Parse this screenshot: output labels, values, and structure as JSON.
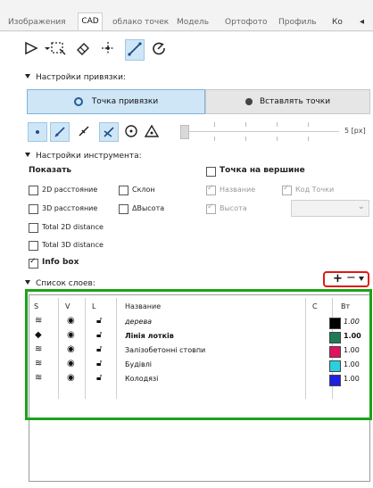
{
  "tabs": [
    "Изображения",
    "CAD",
    "облако точек",
    "Модель",
    "Ортофото",
    "Профиль",
    "Ко"
  ],
  "snap_settings": {
    "title": "Настройки привязки:",
    "snap_point_label": "Точка привязки",
    "insert_points_label": "Вставлять точки",
    "slider_value": "5 [px]"
  },
  "tool_settings": {
    "title": "Настройки инструмента:",
    "show_label": "Показать",
    "point_on_vertex_label": "Точка на вершине",
    "options": {
      "dist2d": "2D расстояние",
      "slope": "Склон",
      "dist3d": "3D расстояние",
      "dheight": "ΔВысота",
      "total2d": "Total 2D distance",
      "total3d": "Total 3D distance",
      "infobox": "Info box",
      "name": "Название",
      "height": "Высота",
      "point_code": "Код Точки"
    }
  },
  "layers": {
    "title": "Список слоев:",
    "controls": {
      "add": "+",
      "remove": "−"
    },
    "headers": {
      "s": "S",
      "v": "V",
      "l": "L",
      "name": "Название",
      "c": "C",
      "width": "Вт"
    },
    "rows": [
      {
        "name": "дерева",
        "width": "1.00",
        "color": "#000000"
      },
      {
        "name": "Лінія лотків",
        "width": "1.00",
        "color": "#1f7a55"
      },
      {
        "name": "Залізобетонні стовпи",
        "width": "1.00",
        "color": "#e0135f"
      },
      {
        "name": "Будівлі",
        "width": "1.00",
        "color": "#29d0e0"
      },
      {
        "name": "Колодязі",
        "width": "1.00",
        "color": "#2020e0"
      }
    ]
  },
  "colors": {
    "highlight_green": "#1aa31a",
    "highlight_red": "#e01818",
    "selected_blue": "#cfe6f7"
  }
}
